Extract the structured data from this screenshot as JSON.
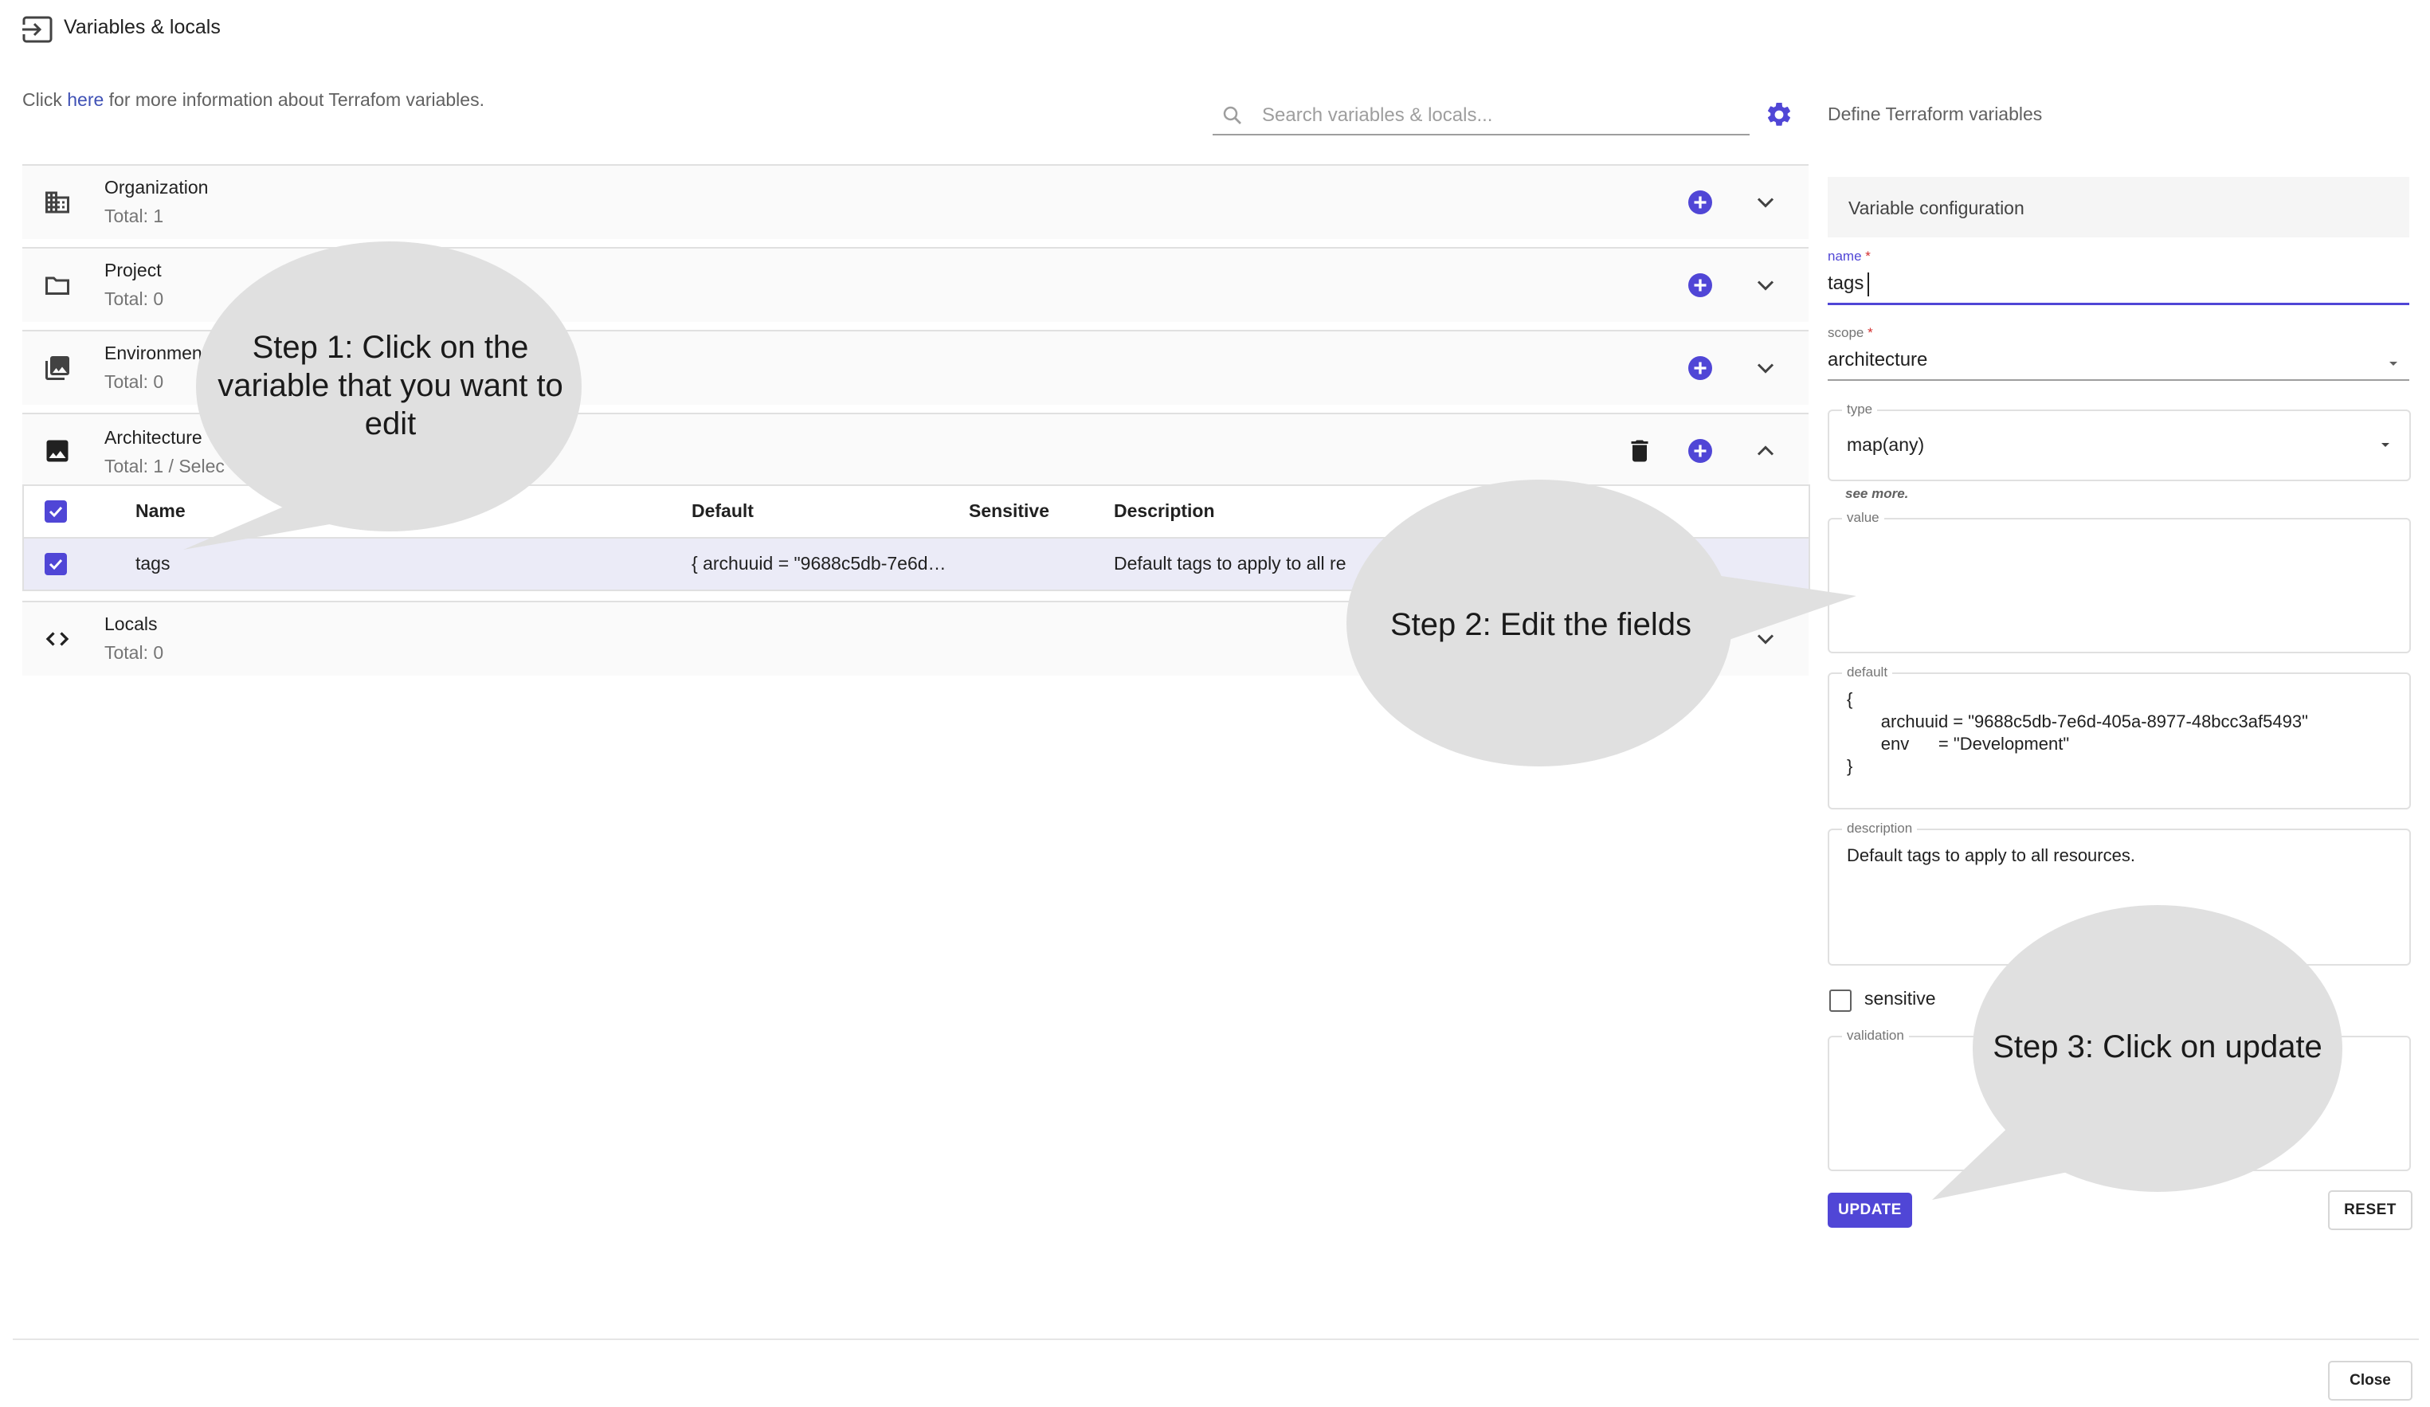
{
  "header": {
    "title": "Variables & locals",
    "info_prefix": "Click ",
    "info_link": "here",
    "info_suffix": " for more information about Terrafom variables."
  },
  "search": {
    "placeholder": "Search variables & locals..."
  },
  "scopes": [
    {
      "title": "Organization",
      "subtitle": "Total: 1",
      "icon": "building-icon"
    },
    {
      "title": "Project",
      "subtitle": "Total: 0",
      "icon": "folder-icon"
    },
    {
      "title": "Environmen",
      "subtitle": "Total: 0",
      "icon": "image-stack-icon"
    },
    {
      "title": "Architecture",
      "subtitle": "Total: 1 / Selec",
      "icon": "image-icon"
    },
    {
      "title": "Locals",
      "subtitle": "Total: 0",
      "icon": "code-icon"
    }
  ],
  "table": {
    "headers": {
      "name": "Name",
      "default": "Default",
      "sensitive": "Sensitive",
      "description": "Description"
    },
    "rows": [
      {
        "name": "tags",
        "default": "{ archuuid = \"9688c5db-7e6d…",
        "description": "Default tags to apply to all re"
      }
    ]
  },
  "panel": {
    "title": "Define Terraform variables",
    "section": "Variable configuration",
    "name_label": "name",
    "name_value": "tags",
    "scope_label": "scope",
    "scope_value": "architecture",
    "type_label": "type",
    "type_value": "map(any)",
    "see_more": "see more.",
    "value_label": "value",
    "default_label": "default",
    "default_value": "{\n       archuuid = \"9688c5db-7e6d-405a-8977-48bcc3af5493\"\n       env      = \"Development\"\n}",
    "description_label": "description",
    "description_value": "Default tags to apply to all resources.",
    "sensitive_label": "sensitive",
    "validation_label": "validation",
    "update": "UPDATE",
    "reset": "RESET"
  },
  "footer": {
    "close": "Close"
  },
  "callouts": {
    "step1": "Step 1: Click on the variable that you want to edit",
    "step2": "Step 2: Edit the fields",
    "step3": "Step 3: Click on update"
  },
  "colors": {
    "accent": "#5046d6",
    "callout": "#e0e0e0"
  }
}
